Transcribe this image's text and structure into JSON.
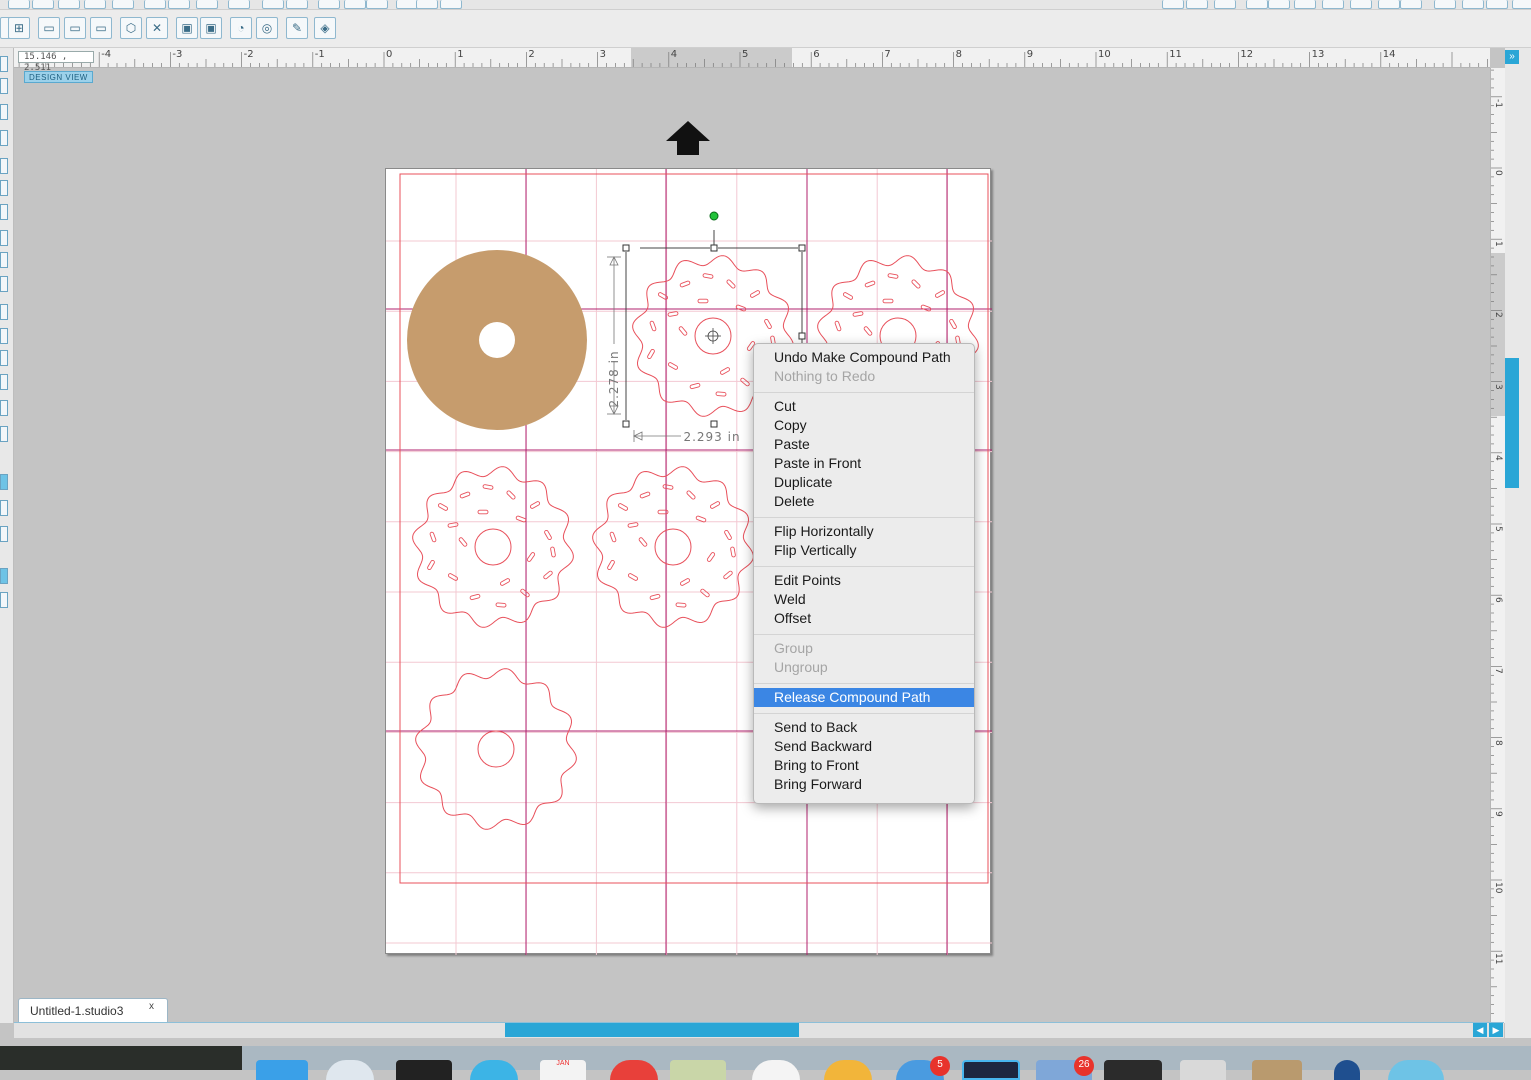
{
  "coordinates": "15.146 , 2.511",
  "view_label": "DESIGN VIEW",
  "ruler": {
    "horizontal": [
      "-4",
      "-3",
      "-2",
      "-1",
      "0",
      "1",
      "2",
      "3",
      "4",
      "5",
      "6",
      "7",
      "8",
      "9",
      "10",
      "11",
      "12",
      "13",
      "14"
    ],
    "vertical": [
      "-1",
      "0",
      "1",
      "2",
      "3",
      "4",
      "5",
      "6",
      "7",
      "8",
      "9",
      "10",
      "11"
    ]
  },
  "selection": {
    "height_label": "2.278 in",
    "width_label": "2.293 in"
  },
  "context_menu": {
    "groups": [
      [
        {
          "label": "Undo Make Compound Path",
          "enabled": true
        },
        {
          "label": "Nothing to Redo",
          "enabled": false
        }
      ],
      [
        {
          "label": "Cut",
          "enabled": true
        },
        {
          "label": "Copy",
          "enabled": true
        },
        {
          "label": "Paste",
          "enabled": true
        },
        {
          "label": "Paste in Front",
          "enabled": true
        },
        {
          "label": "Duplicate",
          "enabled": true
        },
        {
          "label": "Delete",
          "enabled": true
        }
      ],
      [
        {
          "label": "Flip Horizontally",
          "enabled": true
        },
        {
          "label": "Flip Vertically",
          "enabled": true
        }
      ],
      [
        {
          "label": "Edit Points",
          "enabled": true
        },
        {
          "label": "Weld",
          "enabled": true
        },
        {
          "label": "Offset",
          "enabled": true
        }
      ],
      [
        {
          "label": "Group",
          "enabled": false
        },
        {
          "label": "Ungroup",
          "enabled": false
        }
      ],
      [
        {
          "label": "Release Compound Path",
          "enabled": true,
          "selected": true
        }
      ],
      [
        {
          "label": "Send to Back",
          "enabled": true
        },
        {
          "label": "Send Backward",
          "enabled": true
        },
        {
          "label": "Bring to Front",
          "enabled": true
        },
        {
          "label": "Bring Forward",
          "enabled": true
        }
      ]
    ]
  },
  "document_tab": {
    "name": "Untitled-1.studio3",
    "close": "x"
  },
  "dock": {
    "badges": [
      "5",
      "26"
    ],
    "calendar_month": "JAN"
  },
  "colors": {
    "accent": "#2aa6d6",
    "cut_line": "#e8505b",
    "donut_fill": "#c69c6d",
    "grid_magenta": "#b0206e",
    "menu_highlight": "#3b86e4"
  }
}
